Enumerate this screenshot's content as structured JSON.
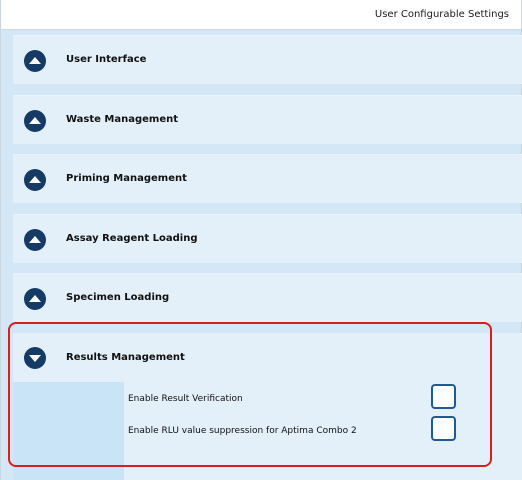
{
  "window": {
    "title": "User Configurable Settings"
  },
  "sections": [
    {
      "label": "User Interface",
      "expanded": false,
      "icon": "chevron-up-icon"
    },
    {
      "label": "Waste Management",
      "expanded": false,
      "icon": "chevron-up-icon"
    },
    {
      "label": "Priming Management",
      "expanded": false,
      "icon": "chevron-up-icon"
    },
    {
      "label": "Assay Reagent Loading",
      "expanded": false,
      "icon": "chevron-up-icon"
    },
    {
      "label": "Specimen Loading",
      "expanded": false,
      "icon": "chevron-up-icon"
    }
  ],
  "results_management": {
    "label": "Results Management",
    "expanded": true,
    "icon": "chevron-down-icon",
    "settings": [
      {
        "label": "Enable Result Verification",
        "checked": false
      },
      {
        "label": "Enable RLU value suppression for Aptima Combo 2",
        "checked": false
      }
    ]
  },
  "colors": {
    "background": "#d3e7f6",
    "panel": "#e3eff9",
    "chevron": "#163a66",
    "checkbox_border": "#1f5b93",
    "highlight": "#d61f1f"
  }
}
